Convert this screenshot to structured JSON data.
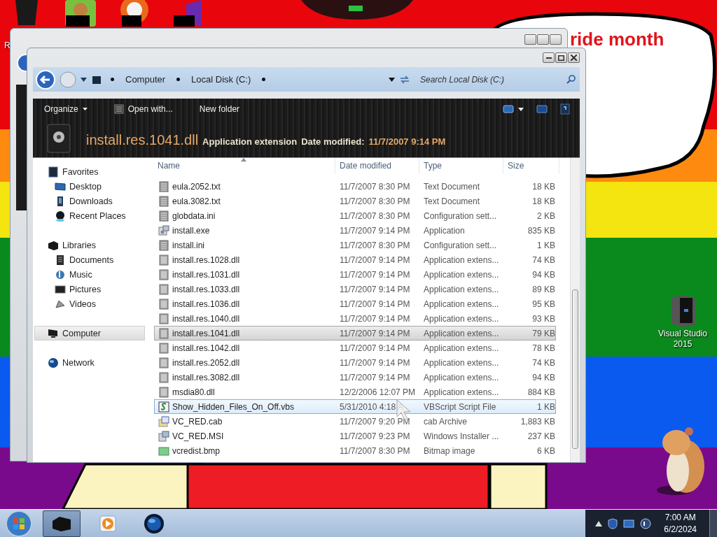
{
  "desktop": {
    "caption": "ride month",
    "icons": [
      {
        "kind": "bin",
        "label": "R"
      },
      {
        "kind": "hamster"
      },
      {
        "kind": "browser"
      },
      {
        "kind": "studio"
      },
      {
        "kind": "studio-large",
        "label": "Visual Studio 2015"
      }
    ]
  },
  "explorer": {
    "breadcrumbs": [
      "Computer",
      "Local Disk (C:)"
    ],
    "search": {
      "placeholder": "Search Local Disk (C:)"
    },
    "toolbar": [
      {
        "kind": "menu",
        "label": "Organize"
      },
      {
        "kind": "icon",
        "label": "Open with..."
      },
      {
        "kind": "plain",
        "label": "New folder"
      }
    ],
    "details": {
      "name": "install.res.1041.dll",
      "type": "Application extension",
      "date_label": "Date modified:",
      "date": "11/7/2007 9:14 PM"
    },
    "nav": [
      {
        "kind": "favorites",
        "label": "Favorites",
        "selected": false,
        "children": [
          {
            "kind": "desktop",
            "label": "Desktop",
            "selected": false
          },
          {
            "kind": "downloads",
            "label": "Downloads",
            "selected": false
          },
          {
            "kind": "recent",
            "label": "Recent Places",
            "selected": false
          }
        ]
      },
      {
        "kind": "libraries",
        "label": "Libraries",
        "selected": false,
        "children": [
          {
            "kind": "documents",
            "label": "Documents",
            "selected": false
          },
          {
            "kind": "music",
            "label": "Music",
            "selected": false
          },
          {
            "kind": "pictures",
            "label": "Pictures",
            "selected": false
          },
          {
            "kind": "videos",
            "label": "Videos",
            "selected": false
          }
        ]
      },
      {
        "kind": "computer",
        "label": "Computer",
        "selected": true
      },
      {
        "kind": "network",
        "label": "Network",
        "selected": false
      }
    ],
    "columns": [
      "Name",
      "Date modified",
      "Type",
      "Size"
    ],
    "rows": [
      {
        "kind": "doc",
        "name": "eula.2052.txt",
        "date": "11/7/2007 8:30 PM",
        "type": "Text Document",
        "size": "18 KB",
        "selected": false,
        "hovered": false
      },
      {
        "kind": "doc",
        "name": "eula.3082.txt",
        "date": "11/7/2007 8:30 PM",
        "type": "Text Document",
        "size": "18 KB",
        "selected": false,
        "hovered": false
      },
      {
        "kind": "doc",
        "name": "globdata.ini",
        "date": "11/7/2007 8:30 PM",
        "type": "Configuration sett...",
        "size": "2 KB",
        "selected": false,
        "hovered": false
      },
      {
        "kind": "exe",
        "name": "install.exe",
        "date": "11/7/2007 9:14 PM",
        "type": "Application",
        "size": "835 KB",
        "selected": false,
        "hovered": false
      },
      {
        "kind": "doc",
        "name": "install.ini",
        "date": "11/7/2007 8:30 PM",
        "type": "Configuration sett...",
        "size": "1 KB",
        "selected": false,
        "hovered": false
      },
      {
        "kind": "dll",
        "name": "install.res.1028.dll",
        "date": "11/7/2007 9:14 PM",
        "type": "Application extens...",
        "size": "74 KB",
        "selected": false,
        "hovered": false
      },
      {
        "kind": "dll",
        "name": "install.res.1031.dll",
        "date": "11/7/2007 9:14 PM",
        "type": "Application extens...",
        "size": "94 KB",
        "selected": false,
        "hovered": false
      },
      {
        "kind": "dll",
        "name": "install.res.1033.dll",
        "date": "11/7/2007 9:14 PM",
        "type": "Application extens...",
        "size": "89 KB",
        "selected": false,
        "hovered": false
      },
      {
        "kind": "dll",
        "name": "install.res.1036.dll",
        "date": "11/7/2007 9:14 PM",
        "type": "Application extens...",
        "size": "95 KB",
        "selected": false,
        "hovered": false
      },
      {
        "kind": "dll",
        "name": "install.res.1040.dll",
        "date": "11/7/2007 9:14 PM",
        "type": "Application extens...",
        "size": "93 KB",
        "selected": false,
        "hovered": false
      },
      {
        "kind": "dll",
        "name": "install.res.1041.dll",
        "date": "11/7/2007 9:14 PM",
        "type": "Application extens...",
        "size": "79 KB",
        "selected": true,
        "hovered": false
      },
      {
        "kind": "dll",
        "name": "install.res.1042.dll",
        "date": "11/7/2007 9:14 PM",
        "type": "Application extens...",
        "size": "78 KB",
        "selected": false,
        "hovered": false
      },
      {
        "kind": "dll",
        "name": "install.res.2052.dll",
        "date": "11/7/2007 9:14 PM",
        "type": "Application extens...",
        "size": "74 KB",
        "selected": false,
        "hovered": false
      },
      {
        "kind": "dll",
        "name": "install.res.3082.dll",
        "date": "11/7/2007 9:14 PM",
        "type": "Application extens...",
        "size": "94 KB",
        "selected": false,
        "hovered": false
      },
      {
        "kind": "dll",
        "name": "msdia80.dll",
        "date": "12/2/2006 12:07 PM",
        "type": "Application extens...",
        "size": "884 KB",
        "selected": false,
        "hovered": false
      },
      {
        "kind": "vbs",
        "name": "Show_Hidden_Files_On_Off.vbs",
        "date": "5/31/2010 4:18 A",
        "type": "VBScript Script File",
        "size": "1 KB",
        "selected": false,
        "hovered": true
      },
      {
        "kind": "cab",
        "name": "VC_RED.cab",
        "date": "11/7/2007 9:20 PM",
        "type": "cab Archive",
        "size": "1,883 KB",
        "selected": false,
        "hovered": false
      },
      {
        "kind": "msi",
        "name": "VC_RED.MSI",
        "date": "11/7/2007 9:23 PM",
        "type": "Windows Installer ...",
        "size": "237 KB",
        "selected": false,
        "hovered": false
      },
      {
        "kind": "bmp",
        "name": "vcredist.bmp",
        "date": "11/7/2007 8:30 PM",
        "type": "Bitmap image",
        "size": "6 KB",
        "selected": false,
        "hovered": false
      }
    ]
  },
  "taskbar": {
    "buttons": [
      {
        "kind": "explorer",
        "selected": true
      },
      {
        "kind": "media",
        "selected": false
      },
      {
        "kind": "globe",
        "selected": false
      }
    ],
    "clock": {
      "time": "7:00 AM",
      "date": "6/2/2024"
    }
  }
}
